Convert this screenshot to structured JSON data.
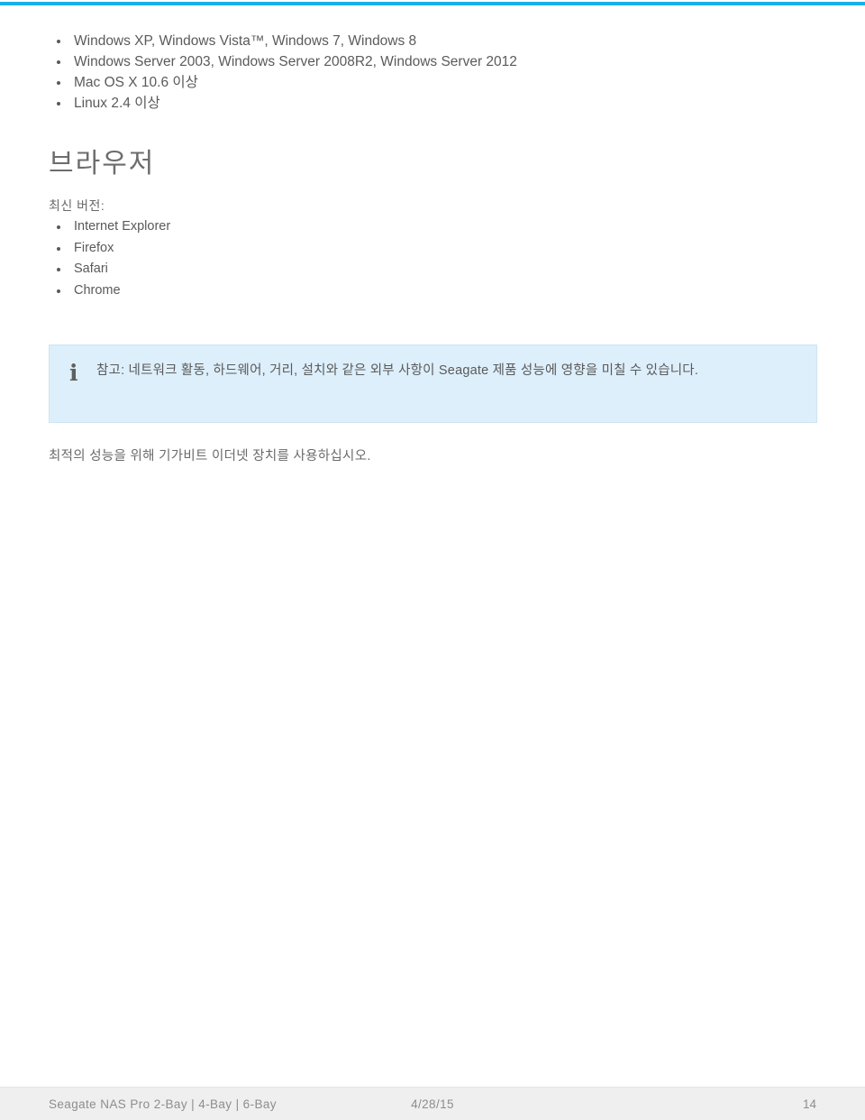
{
  "theme": {
    "accent_rule_color": "#18b0e8",
    "note_background": "#ddeffb",
    "note_border": "#cfe4f2",
    "body_text_color": "#5a5a5a",
    "footer_background": "#efefef"
  },
  "os_list": [
    "Windows XP, Windows Vista™, Windows 7, Windows 8",
    "Windows Server 2003, Windows Server 2008R2, Windows Server 2012",
    "Mac OS X 10.6 이상",
    "Linux 2.4 이상"
  ],
  "browsers_section": {
    "heading": "브라우저",
    "lead": "최신 버전:",
    "items": [
      "Internet Explorer",
      "Firefox",
      "Safari",
      "Chrome"
    ]
  },
  "note": {
    "icon": "info-icon",
    "icon_glyph": "i",
    "text": "참고: 네트워크 활동, 하드웨어, 거리, 설치와 같은 외부 사항이 Seagate 제품 성능에 영향을 미칠 수 있습니다."
  },
  "closing_text": "최적의 성능을 위해 기가비트 이더넷 장치를 사용하십시오.",
  "footer": {
    "product": "Seagate NAS Pro 2-Bay | 4-Bay | 6-Bay",
    "date": "4/28/15",
    "page_number": "14"
  }
}
